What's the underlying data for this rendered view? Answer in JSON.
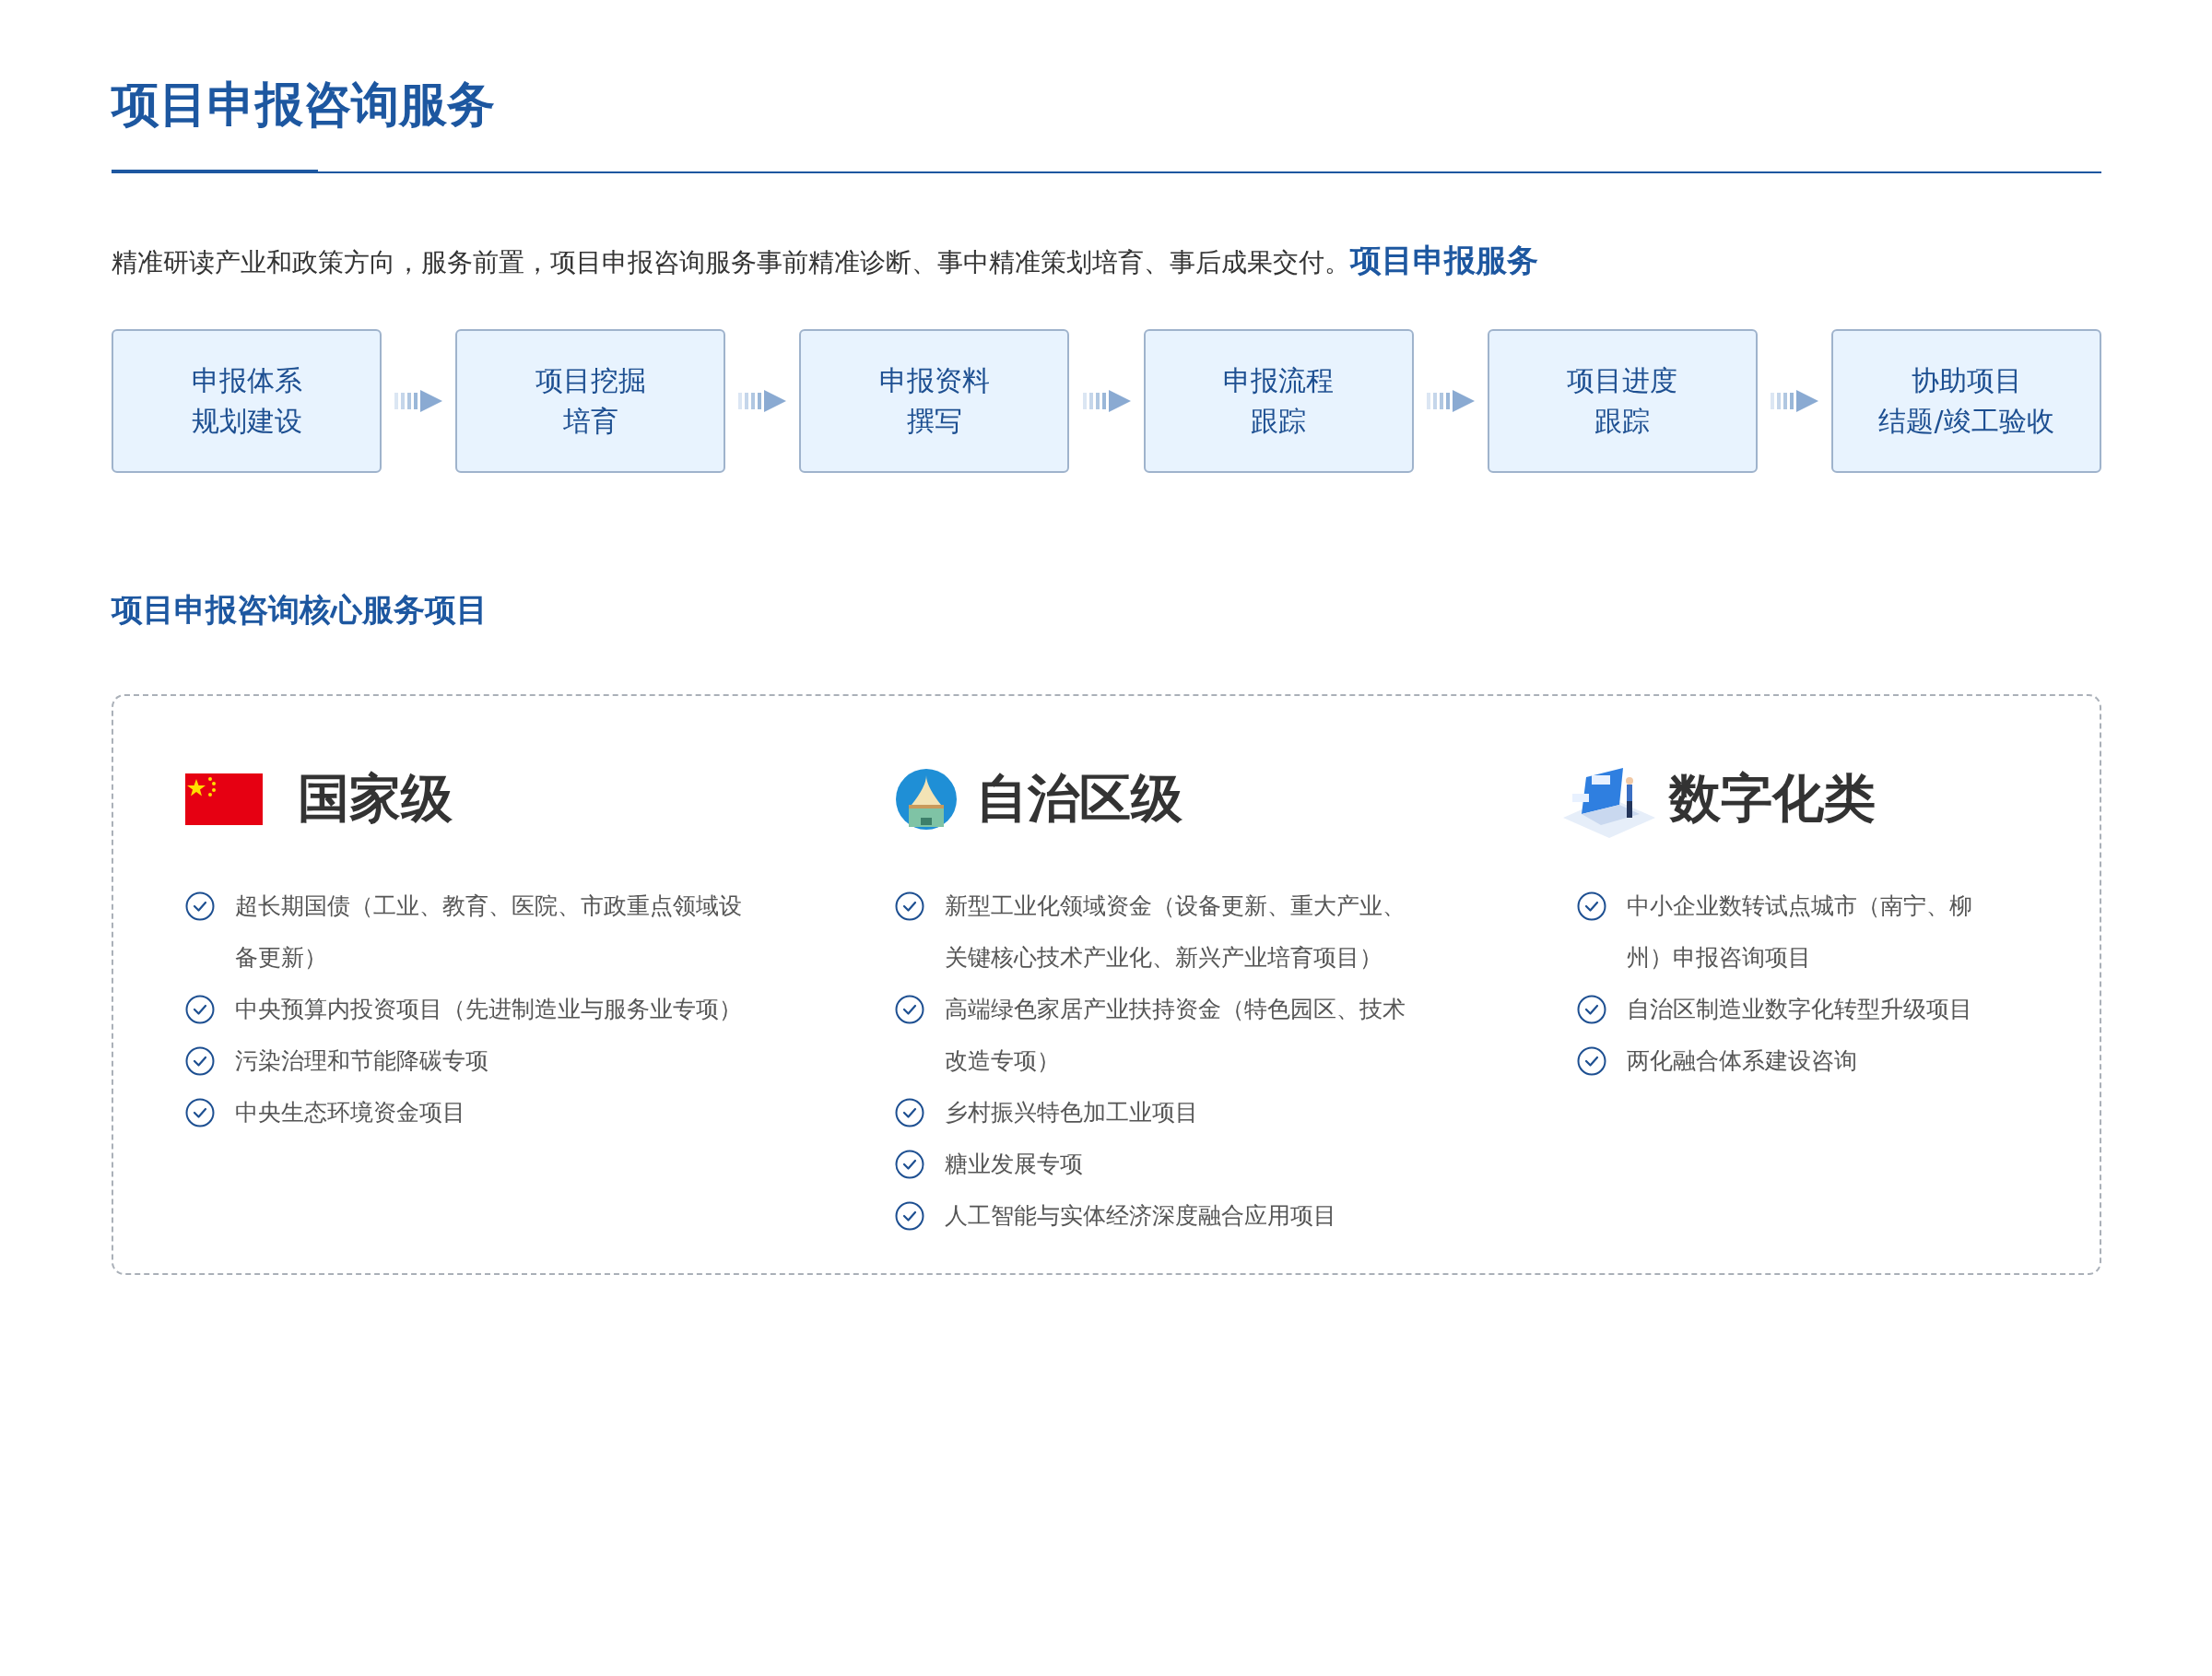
{
  "title": "项目申报咨询服务",
  "intro": "精准研读产业和政策方向，服务前置，项目申报咨询服务事前精准诊断、事中精准策划培育、事后成果交付。",
  "process": {
    "heading": "项目申报服务",
    "steps": [
      {
        "lines": [
          "申报体系",
          "规划建设"
        ]
      },
      {
        "lines": [
          "项目挖掘",
          "培育"
        ]
      },
      {
        "lines": [
          "申报资料",
          "撰写"
        ]
      },
      {
        "lines": [
          "申报流程",
          "跟踪"
        ]
      },
      {
        "lines": [
          "项目进度",
          "跟踪"
        ]
      },
      {
        "lines": [
          "协助项目",
          "结题/竣工验收"
        ]
      }
    ]
  },
  "core": {
    "heading": "项目申报咨询核心服务项目",
    "columns": [
      {
        "kind": "flag",
        "title": "国家级",
        "items": [
          "超长期国债（工业、教育、医院、市政重点领域设备更新）",
          "中央预算内投资项目（先进制造业与服务业专项）",
          "污染治理和节能降碳专项",
          "中央生态环境资金项目"
        ]
      },
      {
        "kind": "building",
        "title": "自治区级",
        "items": [
          "新型工业化领域资金（设备更新、重大产业、关键核心技术产业化、新兴产业培育项目）",
          "高端绿色家居产业扶持资金（特色园区、技术改造专项）",
          "乡村振兴特色加工业项目",
          "糖业发展专项",
          "人工智能与实体经济深度融合应用项目"
        ]
      },
      {
        "kind": "laptop",
        "title": "数字化类",
        "items": [
          "中小企业数转试点城市（南宁、柳州）申报咨询项目",
          "自治区制造业数字化转型升级项目",
          "两化融合体系建设咨询"
        ]
      }
    ]
  }
}
